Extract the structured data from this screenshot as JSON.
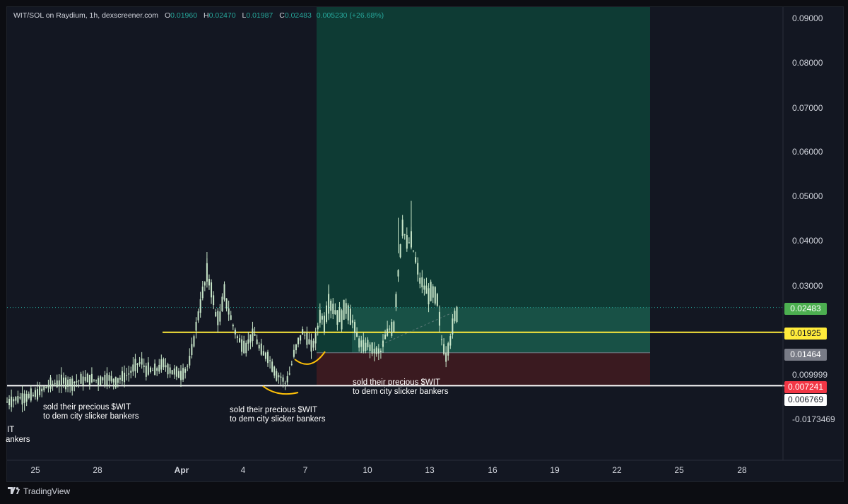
{
  "header": {
    "symbol": "WIT/SOL on Raydium, 1h, dexscreener.com",
    "open_label": "O",
    "open": "0.01960",
    "high_label": "H",
    "high": "0.02470",
    "low_label": "L",
    "low": "0.01987",
    "close_label": "C",
    "close": "0.02483",
    "change": "0.005230 (+26.68%)"
  },
  "brand": "TradingView",
  "annotations": {
    "note1_line1": "sold their precious $WIT",
    "note1_line2": "to dem city slicker bankers",
    "note2_line1": "sold their precious $WIT",
    "note2_line2": "to dem city slicker bankers",
    "note3_line1": "sold their precious $WIT",
    "note3_line2": "to dem city slicker bankers",
    "left_frag1": "IT",
    "left_frag2": "ankers"
  },
  "price_tags": [
    {
      "label": "0.02483",
      "bg": "#4caf50",
      "fg": "#ffffff"
    },
    {
      "label": "0.01925",
      "bg": "#ffeb3b",
      "fg": "#131722"
    },
    {
      "label": "0.01464",
      "bg": "#787b86",
      "fg": "#ffffff"
    },
    {
      "label": "0.007241",
      "bg": "#f23645",
      "fg": "#ffffff"
    },
    {
      "label": "0.006769",
      "bg": "#ffffff",
      "fg": "#131722"
    }
  ],
  "colors": {
    "up": "#26a69a",
    "candle": "#c8e6c9",
    "profit_zone": "#0e3b34",
    "loss_zone": "#3a1a20",
    "level_yellow": "#ffeb3b",
    "level_white": "#ffffff"
  },
  "chart_data": {
    "type": "candlestick",
    "title": "WIT/SOL on Raydium, 1h, dexscreener.com",
    "y_tick_labels": [
      "0.09000",
      "0.08000",
      "0.07000",
      "0.06000",
      "0.05000",
      "0.04000",
      "0.03000",
      "0.009999",
      "-0.0173469"
    ],
    "x_tick_labels": [
      "25",
      "28",
      "Apr",
      "4",
      "7",
      "10",
      "13",
      "16",
      "19",
      "22",
      "25",
      "28"
    ],
    "ylim": [
      -0.004,
      0.092
    ],
    "horizontal_levels": [
      {
        "price": 0.01925,
        "color": "yellow"
      },
      {
        "price": 0.007241,
        "color": "white"
      }
    ],
    "position": {
      "type": "long",
      "entry": 0.01464,
      "target": 0.092,
      "stop": 0.00724,
      "current": 0.02483,
      "start_x": "Apr 7",
      "end_x": "Apr 23"
    },
    "price_path": [
      [
        0,
        0.0036
      ],
      [
        3,
        0.0045
      ],
      [
        6,
        0.005
      ],
      [
        8,
        0.0062
      ],
      [
        10,
        0.0075
      ],
      [
        13,
        0.0082
      ],
      [
        15,
        0.0078
      ],
      [
        17,
        0.0085
      ],
      [
        19,
        0.0088
      ],
      [
        21,
        0.0084
      ],
      [
        23,
        0.009
      ],
      [
        25,
        0.0083
      ],
      [
        28,
        0.0099
      ],
      [
        30,
        0.0121
      ],
      [
        31,
        0.0125
      ],
      [
        32,
        0.0108
      ],
      [
        34,
        0.0106
      ],
      [
        36,
        0.0121
      ],
      [
        38,
        0.0104
      ],
      [
        40,
        0.0098
      ],
      [
        41,
        0.0107
      ],
      [
        42,
        0.0126
      ],
      [
        43,
        0.0175
      ],
      [
        44,
        0.0232
      ],
      [
        45,
        0.0279
      ],
      [
        46,
        0.0322
      ],
      [
        47,
        0.0292
      ],
      [
        48,
        0.0232
      ],
      [
        49,
        0.0225
      ],
      [
        50,
        0.0279
      ],
      [
        51,
        0.0241
      ],
      [
        52,
        0.0208
      ],
      [
        53,
        0.0181
      ],
      [
        54,
        0.0166
      ],
      [
        55,
        0.016
      ],
      [
        56,
        0.0181
      ],
      [
        57,
        0.0186
      ],
      [
        58,
        0.0159
      ],
      [
        59,
        0.0144
      ],
      [
        60,
        0.0139
      ],
      [
        61,
        0.0118
      ],
      [
        62,
        0.0097
      ],
      [
        63,
        0.0092
      ],
      [
        64,
        0.0078
      ],
      [
        65,
        0.0099
      ],
      [
        66,
        0.0143
      ],
      [
        67,
        0.0171
      ],
      [
        68,
        0.0192
      ],
      [
        69,
        0.0181
      ],
      [
        70,
        0.0159
      ],
      [
        71,
        0.0176
      ],
      [
        72,
        0.0232
      ],
      [
        73,
        0.0216
      ],
      [
        74,
        0.0262
      ],
      [
        75,
        0.0248
      ],
      [
        76,
        0.023
      ],
      [
        77,
        0.0226
      ],
      [
        78,
        0.0249
      ],
      [
        79,
        0.0232
      ],
      [
        80,
        0.02
      ],
      [
        81,
        0.0171
      ],
      [
        82,
        0.0159
      ],
      [
        83,
        0.0165
      ],
      [
        84,
        0.0154
      ],
      [
        85,
        0.0149
      ],
      [
        86,
        0.0149
      ],
      [
        87,
        0.0181
      ],
      [
        88,
        0.02
      ],
      [
        89,
        0.0208
      ],
      [
        90,
        0.0327
      ],
      [
        91,
        0.0432
      ],
      [
        92,
        0.0392
      ],
      [
        93,
        0.0397
      ],
      [
        94,
        0.0354
      ],
      [
        95,
        0.031
      ],
      [
        96,
        0.0294
      ],
      [
        97,
        0.0278
      ],
      [
        98,
        0.028
      ],
      [
        99,
        0.0262
      ],
      [
        100,
        0.0176
      ],
      [
        101,
        0.0139
      ],
      [
        102,
        0.0176
      ],
      [
        103,
        0.0226
      ],
      [
        104,
        0.0248
      ]
    ]
  }
}
